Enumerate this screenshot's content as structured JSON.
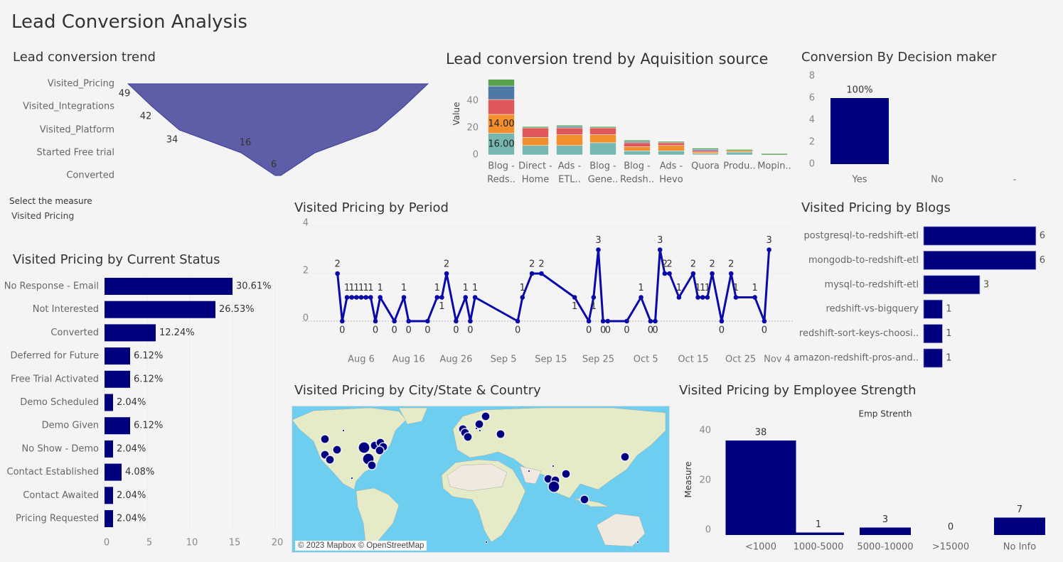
{
  "dashboard": {
    "title": "Lead Conversion Analysis"
  },
  "colors": {
    "bar": "#00007f",
    "funnel": "#5e5ea8",
    "line": "#0a0aa8",
    "water": "#6ecef0",
    "land": "#e5ebc6",
    "desert": "#efe9df",
    "stack": [
      "#76b7b2",
      "#f28e2b",
      "#e15759",
      "#4e79a7",
      "#59a14f"
    ]
  },
  "measure_selector": {
    "label": "Select the measure",
    "value": "Visited Pricing"
  },
  "chart_data": [
    {
      "id": "funnel",
      "type": "funnel",
      "title": "Lead conversion trend",
      "categories": [
        "Visited_Pricing",
        "Visited_Integrations",
        "Visited_Platform",
        "Started Free trial",
        "Converted"
      ],
      "values": [
        49,
        42,
        34,
        16,
        6
      ]
    },
    {
      "id": "acq",
      "type": "bar",
      "stacked": true,
      "title": "Lead conversion trend by Aquisition source",
      "ylabel": "Value",
      "yticks": [
        0,
        20,
        40
      ],
      "categories": [
        [
          "Blog -",
          "Reds.."
        ],
        [
          "Direct -",
          "Home"
        ],
        [
          "Ads -",
          "ETL.."
        ],
        [
          "Blog -",
          "Gene.."
        ],
        [
          "Blog -",
          "Redsh.."
        ],
        [
          "Ads -",
          "Hevo"
        ],
        [
          "Quora",
          ""
        ],
        [
          "Produ..",
          ""
        ],
        [
          "Mopin..",
          ""
        ]
      ],
      "series": [
        {
          "values": [
            16,
            7,
            7,
            9,
            3,
            3,
            1,
            2,
            0
          ]
        },
        {
          "values": [
            14,
            6,
            8,
            6,
            3,
            4,
            1,
            1,
            0
          ]
        },
        {
          "values": [
            11,
            7,
            5,
            5,
            3,
            2,
            1,
            0,
            0
          ]
        },
        {
          "values": [
            10,
            0,
            1,
            0,
            1,
            0,
            1,
            0,
            0
          ]
        },
        {
          "values": [
            5,
            1,
            1,
            1,
            1,
            1,
            1,
            1,
            1
          ]
        }
      ],
      "data_labels": [
        {
          "category": 0,
          "series": 0,
          "text": "16.00"
        },
        {
          "category": 0,
          "series": 1,
          "text": "14.00"
        }
      ]
    },
    {
      "id": "decision",
      "type": "bar",
      "title": "Conversion By Decision maker",
      "categories": [
        "Yes",
        "No",
        "-"
      ],
      "values": [
        6,
        0,
        0
      ],
      "labels": [
        "100%",
        "",
        ""
      ],
      "yticks": [
        0,
        2,
        4,
        6,
        8
      ],
      "ylim": [
        0,
        8
      ]
    },
    {
      "id": "period",
      "type": "line",
      "title": "Visited Pricing by Period",
      "yticks": [
        0,
        2,
        4
      ],
      "ylim": [
        0,
        4
      ],
      "xticks": [
        "Aug 6",
        "Aug 16",
        "Aug 26",
        "Sep 5",
        "Sep 15",
        "Sep 25",
        "Oct 5",
        "Oct 15",
        "Oct 25",
        "Nov 4"
      ],
      "x": [
        "Aug 1",
        "Aug 2",
        "Aug 3",
        "Aug 4",
        "Aug 5",
        "Aug 6",
        "Aug 7",
        "Aug 8",
        "Aug 9",
        "Aug 10",
        "Aug 13",
        "Aug 15",
        "Aug 16",
        "Aug 20",
        "Aug 22",
        "Aug 23",
        "Aug 24",
        "Aug 26",
        "Aug 28",
        "Aug 29",
        "Aug 30",
        "Sep 8",
        "Sep 9",
        "Sep 11",
        "Sep 13",
        "Sep 20",
        "Sep 23",
        "Sep 24",
        "Sep 25",
        "Sep 26",
        "Sep 27",
        "Oct 1",
        "Oct 4",
        "Oct 6",
        "Oct 7",
        "Oct 8",
        "Oct 9",
        "Oct 10",
        "Oct 12",
        "Oct 15",
        "Oct 16",
        "Oct 17",
        "Oct 18",
        "Oct 19",
        "Oct 21",
        "Oct 23",
        "Oct 24",
        "Oct 28",
        "Oct 30",
        "Oct 31"
      ],
      "y": [
        2,
        0,
        1,
        1,
        1,
        1,
        1,
        1,
        0,
        1,
        0,
        1,
        0,
        0,
        1,
        1,
        2,
        0,
        1,
        0,
        1,
        0,
        1,
        2,
        2,
        1,
        0,
        1,
        3,
        0,
        0,
        0,
        1,
        0,
        0,
        3,
        2,
        2,
        1,
        2,
        1,
        1,
        1,
        2,
        0,
        2,
        1,
        1,
        0,
        3
      ]
    },
    {
      "id": "status",
      "type": "bar",
      "orientation": "horizontal",
      "title": "Visited Pricing by Current Status",
      "categories": [
        "No Response - Email",
        "Not Interested",
        "Converted",
        "Deferred for Future",
        "Free Trial Activated",
        "Demo Scheduled",
        "Demo Given",
        "No Show - Demo",
        "Contact Established",
        "Contact Awaited",
        "Pricing Requested"
      ],
      "values": [
        15,
        13,
        6,
        3,
        3,
        1,
        3,
        1,
        2,
        1,
        1
      ],
      "labels": [
        "30.61%",
        "26.53%",
        "12.24%",
        "6.12%",
        "6.12%",
        "2.04%",
        "6.12%",
        "2.04%",
        "4.08%",
        "2.04%",
        "2.04%"
      ],
      "xticks": [
        0,
        5,
        10,
        15,
        20
      ],
      "xlim": [
        0,
        20
      ]
    },
    {
      "id": "blogs",
      "type": "bar",
      "orientation": "horizontal",
      "title": "Visited Pricing by Blogs",
      "categories": [
        "postgresql-to-redshift-etl",
        "mongodb-to-redshift-etl",
        "mysql-to-redshift-etl",
        "redshift-vs-bigquery",
        "redshift-sort-keys-choosi..",
        "amazon-redshift-pros-and.."
      ],
      "values": [
        6,
        6,
        3,
        1,
        1,
        1
      ]
    },
    {
      "id": "emp",
      "type": "bar",
      "title": "Visited Pricing by Employee Strength",
      "subtitle": "Emp Strenth",
      "ylabel": "Measure",
      "yticks": [
        0,
        20,
        40
      ],
      "categories": [
        "<1000",
        "1000-5000",
        "5000-10000",
        ">15000",
        "No Info"
      ],
      "values": [
        38,
        1,
        3,
        0,
        7
      ]
    }
  ],
  "map": {
    "title": "Visited Pricing by City/State & Country",
    "attribution": "© 2023 Mapbox © OpenStreetMap"
  }
}
